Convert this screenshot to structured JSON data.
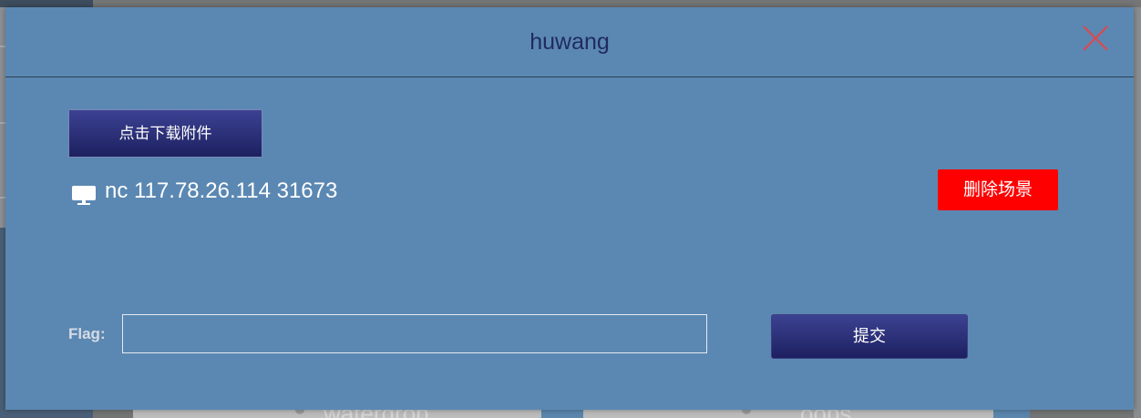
{
  "modal": {
    "title": "huwang",
    "download_button_label": "点击下载附件",
    "connection_text": "nc 117.78.26.114 31673",
    "delete_scene_button_label": "删除场景",
    "flag_label": "Flag:",
    "submit_button_label": "提交",
    "icons": {
      "close": "close-icon",
      "connection": "monitor-icon"
    }
  },
  "background": {
    "cards": [
      {
        "title": "watergrop",
        "icon": "user-icon"
      },
      {
        "title": "oops",
        "icon": "user-icon"
      }
    ]
  },
  "colors": {
    "backdrop": "#747576",
    "modal_background": "#5b88b2",
    "title_text": "#1f2b5e",
    "close_icon": "#e0474c",
    "delete_button": "#ff0000",
    "primary_button": "#2a2f78"
  }
}
